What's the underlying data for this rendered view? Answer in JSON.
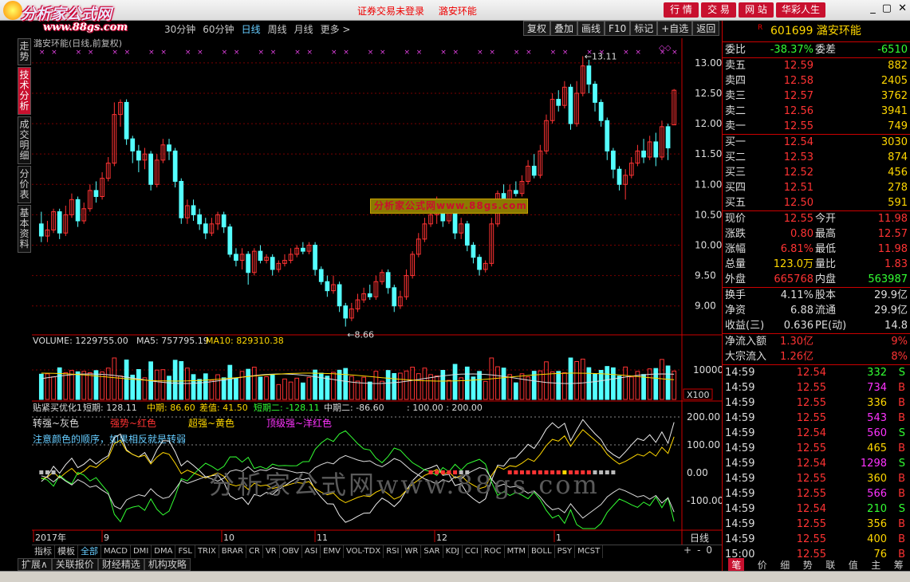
{
  "logo": {
    "brand": "分析家公式网",
    "url": "www.88gs.com"
  },
  "titlebar": {
    "login_status": "证券交易未登录",
    "stock_name": "潞安环能",
    "buttons": [
      "行 情",
      "交 易",
      "网 站",
      "华彩人生"
    ],
    "window_controls": [
      "_",
      "▢",
      "✕"
    ]
  },
  "toolbar": {
    "periods": [
      "30分钟",
      "60分钟",
      "日线",
      "周线",
      "月线",
      "更多 >"
    ],
    "active_period": "日线",
    "right_buttons": [
      "复权",
      "叠加",
      "画线",
      "F10",
      "标记",
      "+自选",
      "返回"
    ]
  },
  "left_tabs": [
    "走势",
    "技术分析",
    "成交明细",
    "分价表",
    "基本资料"
  ],
  "left_tab_active": "技术分析",
  "chart_title": "潞安环能(日线,前复权)",
  "chart_data": {
    "type": "candlestick",
    "y_ticks": [
      "13.00",
      "12.50",
      "12.00",
      "11.50",
      "11.00",
      "10.50",
      "10.00",
      "9.50",
      "9.00"
    ],
    "ylim": [
      8.55,
      13.3
    ],
    "high_marker": "13.11",
    "low_marker": "8.66",
    "x_labels": [
      "2017年",
      "9",
      "10",
      "11",
      "12",
      "1"
    ],
    "candles": [
      [
        10.35,
        10.15,
        10.55,
        10.05
      ],
      [
        10.15,
        10.25,
        10.4,
        10.05
      ],
      [
        10.25,
        10.55,
        10.6,
        10.2
      ],
      [
        10.55,
        10.2,
        10.6,
        10.1
      ],
      [
        10.2,
        10.5,
        10.65,
        10.15
      ],
      [
        10.5,
        10.75,
        10.85,
        10.45
      ],
      [
        10.75,
        10.4,
        10.8,
        10.3
      ],
      [
        10.4,
        10.6,
        10.7,
        10.35
      ],
      [
        10.6,
        10.9,
        11.0,
        10.55
      ],
      [
        10.9,
        10.8,
        11.05,
        10.7
      ],
      [
        10.8,
        11.1,
        11.2,
        10.75
      ],
      [
        11.1,
        11.35,
        11.45,
        11.05
      ],
      [
        11.35,
        12.15,
        12.35,
        11.3
      ],
      [
        12.15,
        12.35,
        12.4,
        11.95
      ],
      [
        12.35,
        11.75,
        12.4,
        11.65
      ],
      [
        11.75,
        11.55,
        11.8,
        11.35
      ],
      [
        11.55,
        11.4,
        11.65,
        11.2
      ],
      [
        11.4,
        11.5,
        11.6,
        11.25
      ],
      [
        11.5,
        11.0,
        11.55,
        10.9
      ],
      [
        11.0,
        11.4,
        11.5,
        10.95
      ],
      [
        11.4,
        11.65,
        11.75,
        11.35
      ],
      [
        11.65,
        11.55,
        11.75,
        11.4
      ],
      [
        11.55,
        11.05,
        11.6,
        10.95
      ],
      [
        11.05,
        10.45,
        11.1,
        10.35
      ],
      [
        10.45,
        10.65,
        10.75,
        10.35
      ],
      [
        10.65,
        10.5,
        10.75,
        10.4
      ],
      [
        10.5,
        10.35,
        10.6,
        10.25
      ],
      [
        10.35,
        10.2,
        10.45,
        10.1
      ],
      [
        10.2,
        10.35,
        10.45,
        10.15
      ],
      [
        10.35,
        10.5,
        10.55,
        10.25
      ],
      [
        10.5,
        10.3,
        10.55,
        10.2
      ],
      [
        10.3,
        9.85,
        10.35,
        9.8
      ],
      [
        9.85,
        9.75,
        9.95,
        9.65
      ],
      [
        9.75,
        9.85,
        9.95,
        9.6
      ],
      [
        9.85,
        9.55,
        9.9,
        9.35
      ],
      [
        9.55,
        9.9,
        9.95,
        9.5
      ],
      [
        9.9,
        9.75,
        10.0,
        9.7
      ],
      [
        9.75,
        9.8,
        9.85,
        9.7
      ],
      [
        9.8,
        9.6,
        9.85,
        9.5
      ],
      [
        9.6,
        9.7,
        9.75,
        9.55
      ],
      [
        9.7,
        9.75,
        9.85,
        9.65
      ],
      [
        9.75,
        9.85,
        9.95,
        9.7
      ],
      [
        9.85,
        9.95,
        10.0,
        9.8
      ],
      [
        9.95,
        9.9,
        10.05,
        9.85
      ],
      [
        9.9,
        10.0,
        10.05,
        9.85
      ],
      [
        10.0,
        9.6,
        10.05,
        9.5
      ],
      [
        9.6,
        9.4,
        9.65,
        9.35
      ],
      [
        9.4,
        9.25,
        9.5,
        9.15
      ],
      [
        9.25,
        9.35,
        9.5,
        9.2
      ],
      [
        9.35,
        9.0,
        9.4,
        8.9
      ],
      [
        9.0,
        8.8,
        9.05,
        8.66
      ],
      [
        8.8,
        8.95,
        9.05,
        8.75
      ],
      [
        8.95,
        9.1,
        9.2,
        8.9
      ],
      [
        9.1,
        9.2,
        9.3,
        9.05
      ],
      [
        9.2,
        9.15,
        9.35,
        9.1
      ],
      [
        9.15,
        9.4,
        9.5,
        9.1
      ],
      [
        9.4,
        9.55,
        9.6,
        9.35
      ],
      [
        9.55,
        9.3,
        9.6,
        9.2
      ],
      [
        9.3,
        9.0,
        9.35,
        8.9
      ],
      [
        9.0,
        9.15,
        9.25,
        8.95
      ],
      [
        9.15,
        9.5,
        9.6,
        9.1
      ],
      [
        9.5,
        9.85,
        9.9,
        9.45
      ],
      [
        9.85,
        10.1,
        10.2,
        9.8
      ],
      [
        10.1,
        10.35,
        10.45,
        10.05
      ],
      [
        10.35,
        10.5,
        10.65,
        10.3
      ],
      [
        10.5,
        10.7,
        10.8,
        10.35
      ],
      [
        10.7,
        10.4,
        10.75,
        10.3
      ],
      [
        10.4,
        10.55,
        10.65,
        10.35
      ],
      [
        10.55,
        10.2,
        10.7,
        10.1
      ],
      [
        10.2,
        10.35,
        10.45,
        10.1
      ],
      [
        10.35,
        10.0,
        10.4,
        9.9
      ],
      [
        10.0,
        9.8,
        10.05,
        9.7
      ],
      [
        9.8,
        9.6,
        9.85,
        9.5
      ],
      [
        9.6,
        9.7,
        9.75,
        9.55
      ],
      [
        9.7,
        10.35,
        10.45,
        9.65
      ],
      [
        10.35,
        10.85,
        10.9,
        10.3
      ],
      [
        10.85,
        10.7,
        11.0,
        10.6
      ],
      [
        10.7,
        10.9,
        11.0,
        10.65
      ],
      [
        10.9,
        10.85,
        11.05,
        10.8
      ],
      [
        10.85,
        11.05,
        11.15,
        10.8
      ],
      [
        11.05,
        11.3,
        11.4,
        11.0
      ],
      [
        11.3,
        11.15,
        11.5,
        11.1
      ],
      [
        11.15,
        11.55,
        11.65,
        11.1
      ],
      [
        11.55,
        12.05,
        12.15,
        11.5
      ],
      [
        12.05,
        12.4,
        12.5,
        12.0
      ],
      [
        12.4,
        12.3,
        12.55,
        12.2
      ],
      [
        12.3,
        12.6,
        12.7,
        12.25
      ],
      [
        12.6,
        12.0,
        12.65,
        11.9
      ],
      [
        12.0,
        12.5,
        12.7,
        11.95
      ],
      [
        12.5,
        12.95,
        13.11,
        12.45
      ],
      [
        12.95,
        12.65,
        13.05,
        12.5
      ],
      [
        12.65,
        12.35,
        12.7,
        12.2
      ],
      [
        12.35,
        12.05,
        12.4,
        11.95
      ],
      [
        12.05,
        11.55,
        12.1,
        11.4
      ],
      [
        11.55,
        11.25,
        11.6,
        11.1
      ],
      [
        11.25,
        11.0,
        11.3,
        10.9
      ],
      [
        11.0,
        11.15,
        11.25,
        10.75
      ],
      [
        11.15,
        11.35,
        11.45,
        11.1
      ],
      [
        11.35,
        11.55,
        11.65,
        11.3
      ],
      [
        11.55,
        11.45,
        11.75,
        11.35
      ],
      [
        11.45,
        11.7,
        11.8,
        11.4
      ],
      [
        11.7,
        11.45,
        11.85,
        11.3
      ],
      [
        11.45,
        11.95,
        12.05,
        11.4
      ],
      [
        11.95,
        11.6,
        12.0,
        11.4
      ],
      [
        11.98,
        12.55,
        12.57,
        11.98
      ]
    ]
  },
  "volume": {
    "label": "VOLUME: 1229755.00",
    "ma5": "MA5: 757795.19",
    "ma10": "MA10: 829310.38",
    "tick": "10000",
    "unit": "X100"
  },
  "indicator": {
    "name": "贴紧买优化1",
    "duanqi": "短期: 128.11",
    "zhongqi": "中期: 86.60",
    "chazhi": "差值: 41.50",
    "duanqi2": "短期二: -128.11",
    "zhongqi2": "中期二: -86.60",
    "range": ": 100.00 : 200.00",
    "legend1": "转强~灰色",
    "legend2": "强势~红色",
    "legend3": "超强~黄色",
    "legend4": "顶级强~洋红色",
    "note": "注意颜色的顺序，如果相反就是转弱",
    "ticks": [
      "200.00",
      "100.00",
      "0.00",
      "-100.00"
    ]
  },
  "x_period_label": "日线",
  "watermark": {
    "box": "分析家公式网www.88gs.com",
    "big": "分析家公式网www.88gs.com"
  },
  "quote": {
    "code": "601699",
    "name": "潞安环能",
    "weibi_label": "委比",
    "weibi": "-38.37%",
    "weicha_label": "委差",
    "weicha": "-6510",
    "sells": [
      {
        "label": "卖五",
        "price": "12.59",
        "vol": "882"
      },
      {
        "label": "卖四",
        "price": "12.58",
        "vol": "2405"
      },
      {
        "label": "卖三",
        "price": "12.57",
        "vol": "3762"
      },
      {
        "label": "卖二",
        "price": "12.56",
        "vol": "3941"
      },
      {
        "label": "卖一",
        "price": "12.55",
        "vol": "749"
      }
    ],
    "buys": [
      {
        "label": "买一",
        "price": "12.54",
        "vol": "3030"
      },
      {
        "label": "买二",
        "price": "12.53",
        "vol": "874"
      },
      {
        "label": "买三",
        "price": "12.52",
        "vol": "456"
      },
      {
        "label": "买四",
        "price": "12.51",
        "vol": "278"
      },
      {
        "label": "买五",
        "price": "12.50",
        "vol": "591"
      }
    ],
    "stats": [
      {
        "a": "现价",
        "b": "12.55",
        "bc": "red",
        "c": "今开",
        "d": "11.98",
        "dc": "red"
      },
      {
        "a": "涨跌",
        "b": "0.80",
        "bc": "red",
        "c": "最高",
        "d": "12.57",
        "dc": "red"
      },
      {
        "a": "涨幅",
        "b": "6.81%",
        "bc": "red",
        "c": "最低",
        "d": "11.98",
        "dc": "red"
      },
      {
        "a": "总量",
        "b": "123.0万",
        "bc": "yel",
        "c": "量比",
        "d": "1.83",
        "dc": "red"
      },
      {
        "a": "外盘",
        "b": "665768",
        "bc": "red",
        "c": "内盘",
        "d": "563987",
        "dc": "grn"
      }
    ],
    "stats2": [
      {
        "a": "换手",
        "b": "4.11%",
        "bc": "wht",
        "c": "股本",
        "d": "29.9亿",
        "dc": "wht"
      },
      {
        "a": "净资",
        "b": "6.88",
        "bc": "wht",
        "c": "流通",
        "d": "29.9亿",
        "dc": "wht"
      },
      {
        "a": "收益(三)",
        "b": "0.636",
        "bc": "wht",
        "c": "PE(动)",
        "d": "14.8",
        "dc": "wht"
      }
    ],
    "flows": [
      {
        "a": "净流入额",
        "b": "1.30亿",
        "c": "9%"
      },
      {
        "a": "大宗流入",
        "b": "1.26亿",
        "c": "8%"
      }
    ],
    "ticks": [
      {
        "t": "14:59",
        "p": "12.54",
        "v": "332",
        "vc": "grn",
        "s": "S",
        "sc": "grn"
      },
      {
        "t": "14:59",
        "p": "12.55",
        "v": "734",
        "vc": "mag",
        "s": "B",
        "sc": "red"
      },
      {
        "t": "14:59",
        "p": "12.55",
        "v": "336",
        "vc": "yel",
        "s": "B",
        "sc": "red"
      },
      {
        "t": "14:59",
        "p": "12.55",
        "v": "543",
        "vc": "mag",
        "s": "B",
        "sc": "red"
      },
      {
        "t": "14:59",
        "p": "12.54",
        "v": "560",
        "vc": "mag",
        "s": "S",
        "sc": "grn"
      },
      {
        "t": "14:59",
        "p": "12.55",
        "v": "465",
        "vc": "yel",
        "s": "B",
        "sc": "red"
      },
      {
        "t": "14:59",
        "p": "12.54",
        "v": "1298",
        "vc": "mag",
        "s": "S",
        "sc": "grn"
      },
      {
        "t": "14:59",
        "p": "12.55",
        "v": "360",
        "vc": "yel",
        "s": "B",
        "sc": "red"
      },
      {
        "t": "14:59",
        "p": "12.55",
        "v": "566",
        "vc": "mag",
        "s": "B",
        "sc": "red"
      },
      {
        "t": "14:59",
        "p": "12.54",
        "v": "210",
        "vc": "grn",
        "s": "S",
        "sc": "grn"
      },
      {
        "t": "14:59",
        "p": "12.55",
        "v": "356",
        "vc": "yel",
        "s": "B",
        "sc": "red"
      },
      {
        "t": "14:59",
        "p": "12.55",
        "v": "400",
        "vc": "yel",
        "s": "B",
        "sc": "red"
      },
      {
        "t": "15:00",
        "p": "12.55",
        "v": "76",
        "vc": "yel",
        "s": "B",
        "sc": "red"
      }
    ]
  },
  "bottom_tabs": [
    "指标",
    "模板",
    "全部",
    "MACD",
    "DMI",
    "DMA",
    "FSL",
    "TRIX",
    "BRAR",
    "CR",
    "VR",
    "OBV",
    "ASI",
    "EMV",
    "VOL-TDX",
    "RSI",
    "WR",
    "SAR",
    "KDJ",
    "CCI",
    "ROC",
    "MTM",
    "BOLL",
    "PSY",
    "MCST"
  ],
  "bottom_tabs_active": "全部",
  "bottom_right": [
    "+",
    "-",
    "0"
  ],
  "bottom_bar": [
    "扩展∧",
    "关联报价",
    "财经精选",
    "机构攻略"
  ],
  "right_bottom_tabs": [
    "笔",
    "价",
    "细",
    "势",
    "联",
    "值",
    "主",
    "筹"
  ],
  "right_bottom_active": "笔",
  "colors": {
    "up": "#ff3333",
    "down": "#54ffff",
    "bg": "#000000",
    "accent": "#c8102e"
  }
}
